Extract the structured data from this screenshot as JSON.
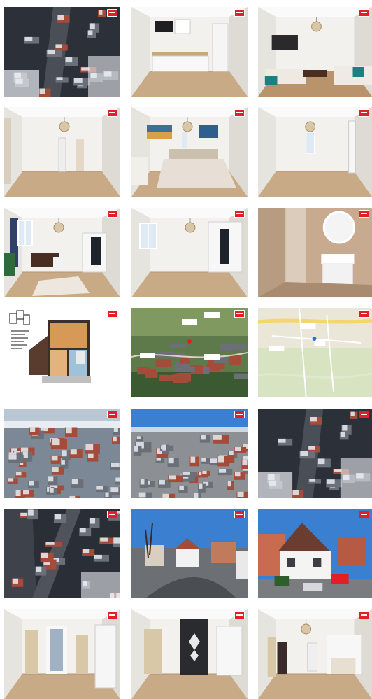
{
  "gallery": {
    "photos": [
      {
        "name": "aerial-street-photo",
        "kind": "aerial-snow"
      },
      {
        "name": "kitchenette-photo",
        "kind": "kitchen"
      },
      {
        "name": "living-room-photo",
        "kind": "living"
      },
      {
        "name": "empty-room-lamp-photo",
        "kind": "room-lamp"
      },
      {
        "name": "bedroom-photo",
        "kind": "bedroom"
      },
      {
        "name": "empty-room-window-photo",
        "kind": "room-window"
      },
      {
        "name": "study-room-photo",
        "kind": "study"
      },
      {
        "name": "empty-room-wardrobe-photo",
        "kind": "room-wardrobe"
      },
      {
        "name": "bathroom-photo",
        "kind": "bathroom"
      },
      {
        "name": "floor-plan-image",
        "kind": "floorplan"
      },
      {
        "name": "satellite-map-image",
        "kind": "satellite"
      },
      {
        "name": "street-map-image",
        "kind": "streetmap"
      },
      {
        "name": "aerial-town-photo",
        "kind": "aerial-town"
      },
      {
        "name": "aerial-town-sky-photo",
        "kind": "aerial-town-sky"
      },
      {
        "name": "aerial-street-photo-2",
        "kind": "aerial-snow"
      },
      {
        "name": "aerial-topdown-photo",
        "kind": "aerial-topdown"
      },
      {
        "name": "house-street-photo",
        "kind": "house-street"
      },
      {
        "name": "house-front-photo",
        "kind": "house-front"
      },
      {
        "name": "hallway-doors-photo",
        "kind": "hallway"
      },
      {
        "name": "entrance-door-photo",
        "kind": "entrance"
      },
      {
        "name": "open-room-photo",
        "kind": "open-room"
      }
    ],
    "colors": {
      "brand_badge": "#e31e24",
      "floor_wood": "#c8ab86",
      "wall_white": "#f2f1ee",
      "sky_blue": "#3a7fd0",
      "snow_white": "#e9edf2",
      "roof_red": "#a44b3a"
    }
  }
}
